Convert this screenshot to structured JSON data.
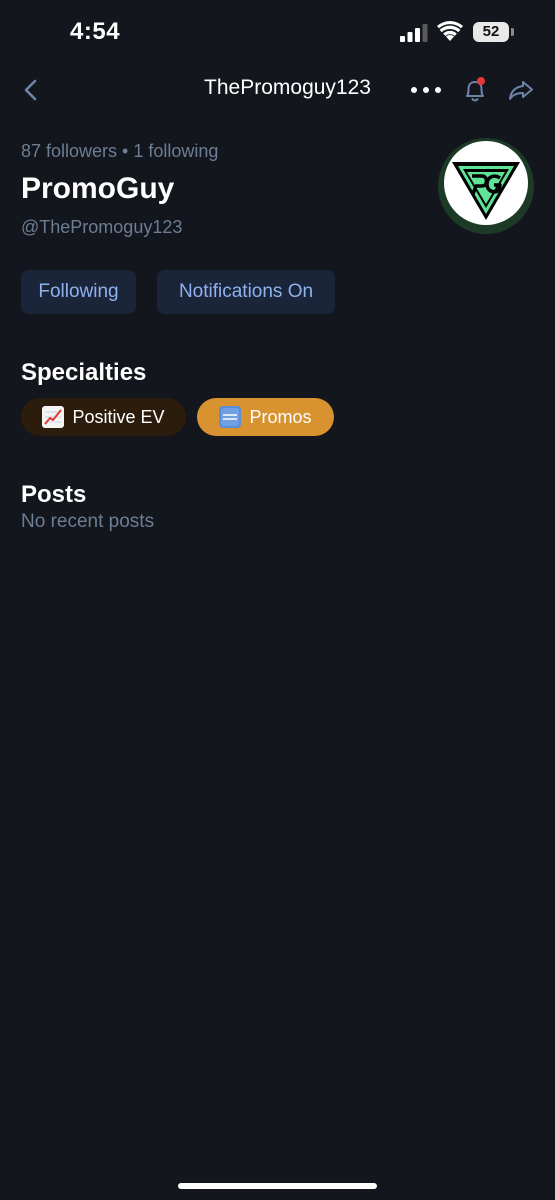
{
  "status_bar": {
    "time": "4:54",
    "battery_level": "52"
  },
  "nav": {
    "title": "ThePromoguy123",
    "icons": [
      "back-icon",
      "more-icon",
      "bell-icon",
      "share-icon"
    ]
  },
  "profile": {
    "stats": "87 followers • 1 following",
    "name": "PromoGuy",
    "handle": "@ThePromoguy123",
    "avatar_logo_text": "PG"
  },
  "actions": {
    "following_label": "Following",
    "notifications_label": "Notifications On"
  },
  "specialties": {
    "title": "Specialties",
    "items": [
      {
        "label": "Positive EV",
        "icon": "chart-increasing-icon"
      },
      {
        "label": "Promos",
        "icon": "free-badge-icon"
      }
    ]
  },
  "posts": {
    "title": "Posts",
    "empty_text": "No recent posts"
  },
  "colors": {
    "background": "#13161c",
    "secondary_text": "#6d7d94",
    "button_bg": "#1b253a",
    "button_text": "#8fb2ec",
    "chip_ev_bg": "#2c1c0c",
    "chip_promos_bg": "#d8922f",
    "avatar_green": "#5fe396",
    "notification_dot": "#e53935"
  }
}
